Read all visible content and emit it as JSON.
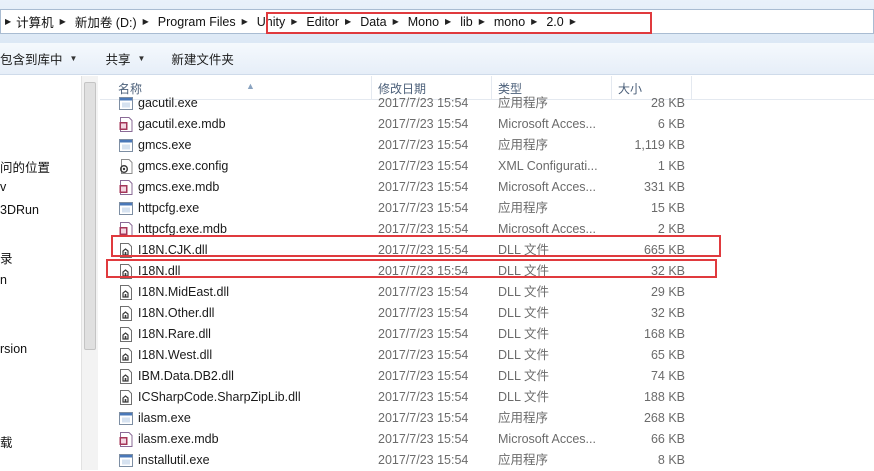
{
  "address": {
    "crumbs": [
      "计算机",
      "新加卷 (D:)",
      "Program Files",
      "Unity",
      "Editor",
      "Data",
      "Mono",
      "lib",
      "mono",
      "2.0"
    ]
  },
  "toolbar": {
    "include_library": "包含到库中",
    "share": "共享",
    "new_folder": "新建文件夹"
  },
  "nav": {
    "items": [
      "问的位置",
      "v",
      "3DRun",
      "录",
      "n",
      "rsion",
      "载"
    ]
  },
  "columns": {
    "name": "名称",
    "date": "修改日期",
    "type": "类型",
    "size": "大小"
  },
  "files": [
    {
      "name": "gacutil.exe",
      "date": "2017/7/23 15:54",
      "type": "应用程序",
      "size": "28 KB",
      "icon": "exe-icon"
    },
    {
      "name": "gacutil.exe.mdb",
      "date": "2017/7/23 15:54",
      "type": "Microsoft Acces...",
      "size": "6 KB",
      "icon": "mdb-icon"
    },
    {
      "name": "gmcs.exe",
      "date": "2017/7/23 15:54",
      "type": "应用程序",
      "size": "1,119 KB",
      "icon": "exe-icon"
    },
    {
      "name": "gmcs.exe.config",
      "date": "2017/7/23 15:54",
      "type": "XML Configurati...",
      "size": "1 KB",
      "icon": "config-icon"
    },
    {
      "name": "gmcs.exe.mdb",
      "date": "2017/7/23 15:54",
      "type": "Microsoft Acces...",
      "size": "331 KB",
      "icon": "mdb-icon"
    },
    {
      "name": "httpcfg.exe",
      "date": "2017/7/23 15:54",
      "type": "应用程序",
      "size": "15 KB",
      "icon": "exe-icon"
    },
    {
      "name": "httpcfg.exe.mdb",
      "date": "2017/7/23 15:54",
      "type": "Microsoft Acces...",
      "size": "2 KB",
      "icon": "mdb-icon"
    },
    {
      "name": "I18N.CJK.dll",
      "date": "2017/7/23 15:54",
      "type": "DLL 文件",
      "size": "665 KB",
      "icon": "dll-icon"
    },
    {
      "name": "I18N.dll",
      "date": "2017/7/23 15:54",
      "type": "DLL 文件",
      "size": "32 KB",
      "icon": "dll-icon"
    },
    {
      "name": "I18N.MidEast.dll",
      "date": "2017/7/23 15:54",
      "type": "DLL 文件",
      "size": "29 KB",
      "icon": "dll-icon"
    },
    {
      "name": "I18N.Other.dll",
      "date": "2017/7/23 15:54",
      "type": "DLL 文件",
      "size": "32 KB",
      "icon": "dll-icon"
    },
    {
      "name": "I18N.Rare.dll",
      "date": "2017/7/23 15:54",
      "type": "DLL 文件",
      "size": "168 KB",
      "icon": "dll-icon"
    },
    {
      "name": "I18N.West.dll",
      "date": "2017/7/23 15:54",
      "type": "DLL 文件",
      "size": "65 KB",
      "icon": "dll-icon"
    },
    {
      "name": "IBM.Data.DB2.dll",
      "date": "2017/7/23 15:54",
      "type": "DLL 文件",
      "size": "74 KB",
      "icon": "dll-icon"
    },
    {
      "name": "ICSharpCode.SharpZipLib.dll",
      "date": "2017/7/23 15:54",
      "type": "DLL 文件",
      "size": "188 KB",
      "icon": "dll-icon"
    },
    {
      "name": "ilasm.exe",
      "date": "2017/7/23 15:54",
      "type": "应用程序",
      "size": "268 KB",
      "icon": "exe-icon"
    },
    {
      "name": "ilasm.exe.mdb",
      "date": "2017/7/23 15:54",
      "type": "Microsoft Acces...",
      "size": "66 KB",
      "icon": "mdb-icon"
    },
    {
      "name": "installutil.exe",
      "date": "2017/7/23 15:54",
      "type": "应用程序",
      "size": "8 KB",
      "icon": "exe-icon"
    }
  ],
  "colors": {
    "highlight": "#e03a3e",
    "header_text": "#4c607a"
  }
}
